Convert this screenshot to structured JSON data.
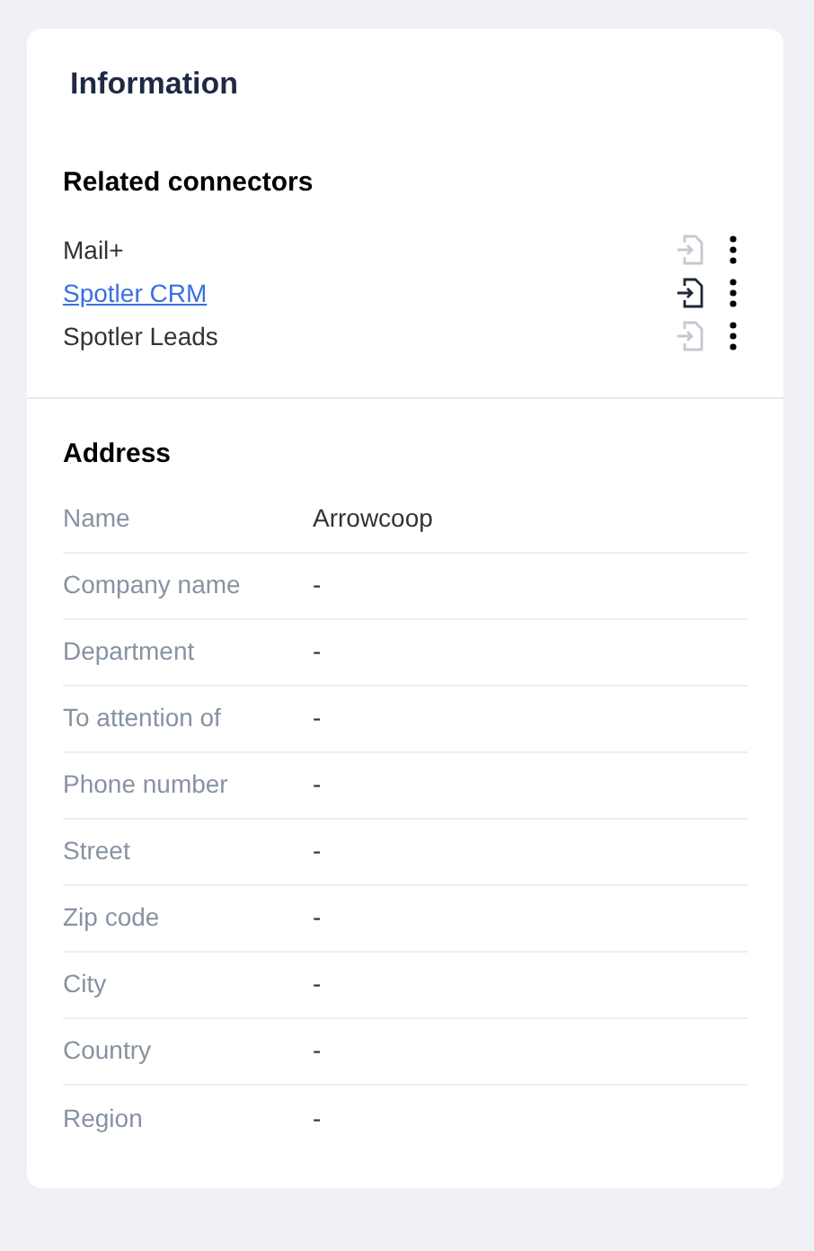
{
  "card": {
    "title": "Information"
  },
  "connectors": {
    "heading": "Related connectors",
    "items": [
      {
        "name": "Mail+",
        "kind": "text",
        "enabled": false
      },
      {
        "name": "Spotler CRM",
        "kind": "link",
        "enabled": true
      },
      {
        "name": "Spotler Leads",
        "kind": "text",
        "enabled": false
      }
    ]
  },
  "address": {
    "heading": "Address",
    "rows": [
      {
        "label": "Name",
        "value": "Arrowcoop"
      },
      {
        "label": "Company name",
        "value": "-"
      },
      {
        "label": "Department",
        "value": "-"
      },
      {
        "label": "To attention of",
        "value": "-"
      },
      {
        "label": "Phone number",
        "value": "-"
      },
      {
        "label": "Street",
        "value": "-"
      },
      {
        "label": "Zip code",
        "value": "-"
      },
      {
        "label": "City",
        "value": "-"
      },
      {
        "label": "Country",
        "value": "-"
      },
      {
        "label": "Region",
        "value": "-"
      }
    ]
  }
}
